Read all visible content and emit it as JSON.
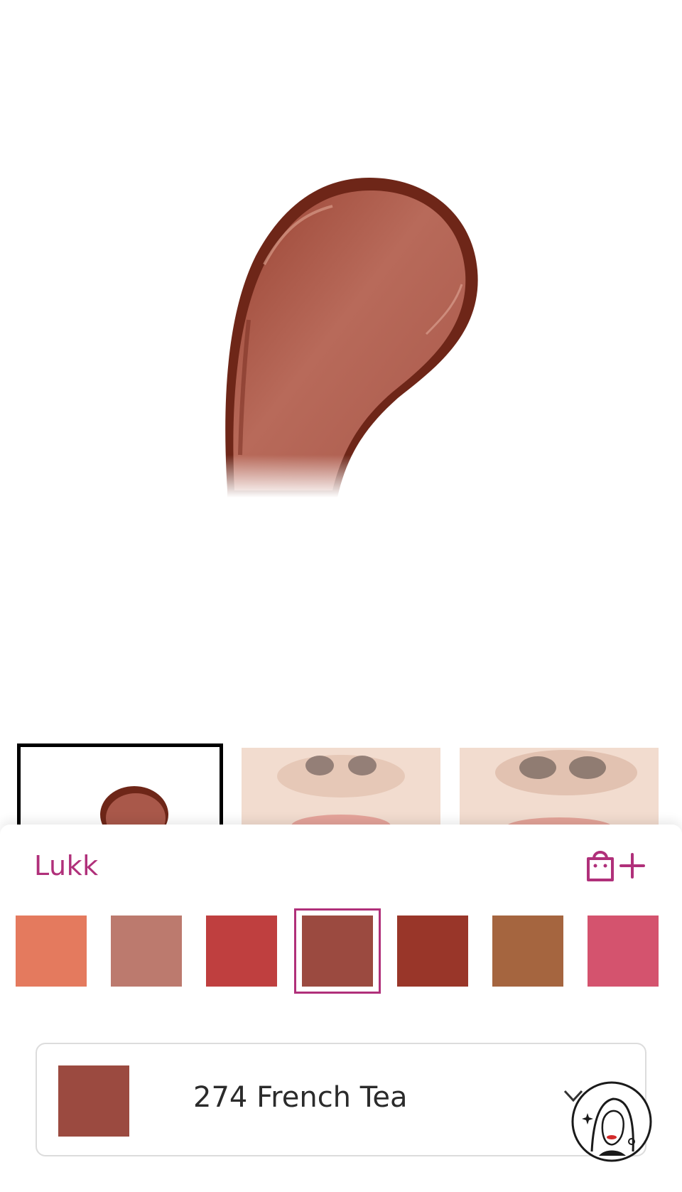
{
  "hero": {
    "image_icon": "lipstick-swatch-smear",
    "colors": {
      "smear_light": "#b86a5a",
      "smear_mid": "#a24e3f",
      "smear_dark": "#6e2618"
    }
  },
  "thumbnails": [
    {
      "icon": "lipstick-swatch-thumb",
      "selected": true
    },
    {
      "icon": "lips-model-thumb",
      "selected": false
    },
    {
      "icon": "lips-model-thumb",
      "selected": false
    }
  ],
  "sheet": {
    "title": "Lukk",
    "add_to_bag_icon": "bag-plus-icon",
    "accent_color": "#b0307a"
  },
  "swatches": [
    {
      "color": "#e47a5e",
      "selected": false
    },
    {
      "color": "#bc7a6e",
      "selected": false
    },
    {
      "color": "#bf3f3f",
      "selected": false
    },
    {
      "color": "#9b4a40",
      "selected": true
    },
    {
      "color": "#993629",
      "selected": false
    },
    {
      "color": "#a5653f",
      "selected": false
    },
    {
      "color": "#d4536e",
      "selected": false
    }
  ],
  "selector": {
    "shade_color": "#9b4a40",
    "label": "274 French Tea",
    "chevron_icon": "chevron-down-icon"
  },
  "assistant": {
    "icon": "beauty-assistant-avatar-icon"
  }
}
